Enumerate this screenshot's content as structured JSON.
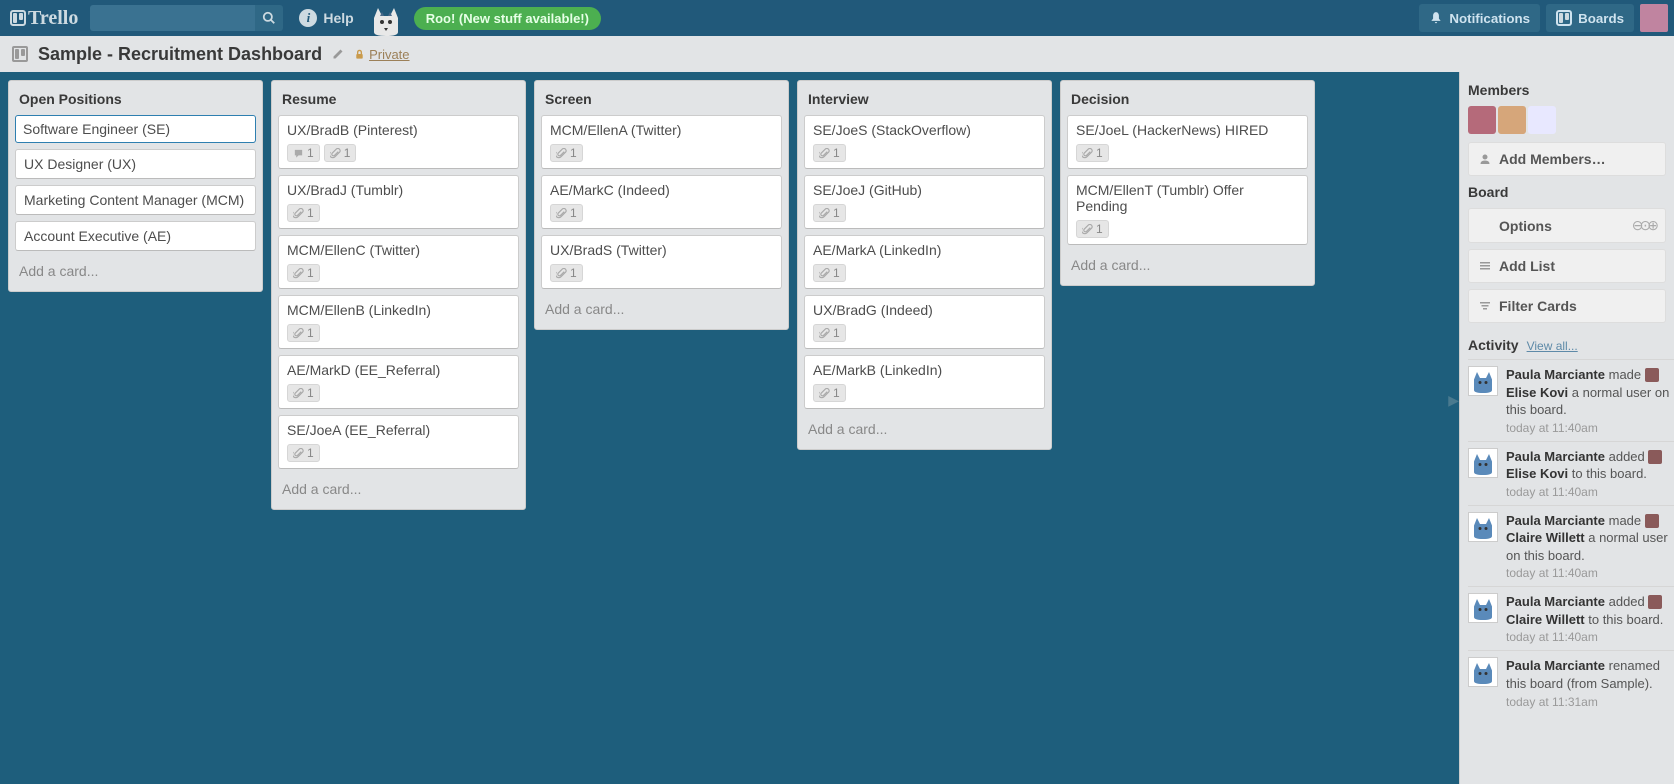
{
  "header": {
    "logo_text": "Trello",
    "help_label": "Help",
    "roo_text": "Roo! (New stuff available!)",
    "notifications_label": "Notifications",
    "boards_label": "Boards"
  },
  "board": {
    "title": "Sample - Recruitment Dashboard",
    "privacy": "Private"
  },
  "lists": [
    {
      "title": "Open Positions",
      "cards": [
        {
          "title": "Software Engineer (SE)",
          "selected": true
        },
        {
          "title": "UX Designer (UX)"
        },
        {
          "title": "Marketing Content Manager (MCM)"
        },
        {
          "title": "Account Executive (AE)"
        }
      ],
      "add_label": "Add a card..."
    },
    {
      "title": "Resume",
      "cards": [
        {
          "title": "UX/BradB (Pinterest)",
          "comments": 1,
          "attachments": 1
        },
        {
          "title": "UX/BradJ (Tumblr)",
          "attachments": 1
        },
        {
          "title": "MCM/EllenC (Twitter)",
          "attachments": 1
        },
        {
          "title": "MCM/EllenB (LinkedIn)",
          "attachments": 1
        },
        {
          "title": "AE/MarkD (EE_Referral)",
          "attachments": 1
        },
        {
          "title": "SE/JoeA (EE_Referral)",
          "attachments": 1
        }
      ],
      "add_label": "Add a card..."
    },
    {
      "title": "Screen",
      "cards": [
        {
          "title": "MCM/EllenA (Twitter)",
          "attachments": 1
        },
        {
          "title": "AE/MarkC (Indeed)",
          "attachments": 1
        },
        {
          "title": "UX/BradS (Twitter)",
          "attachments": 1
        }
      ],
      "add_label": "Add a card..."
    },
    {
      "title": "Interview",
      "cards": [
        {
          "title": "SE/JoeS (StackOverflow)",
          "attachments": 1
        },
        {
          "title": "SE/JoeJ (GitHub)",
          "attachments": 1
        },
        {
          "title": "AE/MarkA (LinkedIn)",
          "attachments": 1
        },
        {
          "title": "UX/BradG (Indeed)",
          "attachments": 1
        },
        {
          "title": "AE/MarkB (LinkedIn)",
          "attachments": 1
        }
      ],
      "add_label": "Add a card..."
    },
    {
      "title": "Decision",
      "cards": [
        {
          "title": "SE/JoeL (HackerNews) HIRED",
          "attachments": 1
        },
        {
          "title": "MCM/EllenT (Tumblr) Offer Pending",
          "attachments": 1
        }
      ],
      "add_label": "Add a card..."
    }
  ],
  "sidebar": {
    "members_heading": "Members",
    "member_colors": [
      "#b56a7a",
      "#d6a67a",
      "#e8e8ff"
    ],
    "add_members": "Add Members…",
    "board_heading": "Board",
    "options_label": "Options",
    "add_list_label": "Add List",
    "filter_label": "Filter Cards",
    "activity_heading": "Activity",
    "view_all": "View all...",
    "activity": [
      {
        "text_parts": [
          "Paula Marciante",
          " made ",
          "AVA",
          " ",
          "Elise Kovi",
          " a normal user on this board."
        ],
        "time": "today at 11:40am"
      },
      {
        "text_parts": [
          "Paula Marciante",
          " added ",
          "AVA",
          " ",
          "Elise Kovi",
          " to this board."
        ],
        "time": "today at 11:40am"
      },
      {
        "text_parts": [
          "Paula Marciante",
          " made ",
          "AVA",
          " ",
          "Claire Willett",
          " a normal user on this board."
        ],
        "time": "today at 11:40am"
      },
      {
        "text_parts": [
          "Paula Marciante",
          " added ",
          "AVA",
          " ",
          "Claire Willett",
          " to this board."
        ],
        "time": "today at 11:40am"
      },
      {
        "text_parts": [
          "Paula Marciante",
          " renamed this board (from Sample)."
        ],
        "time": "today at 11:31am"
      }
    ]
  }
}
